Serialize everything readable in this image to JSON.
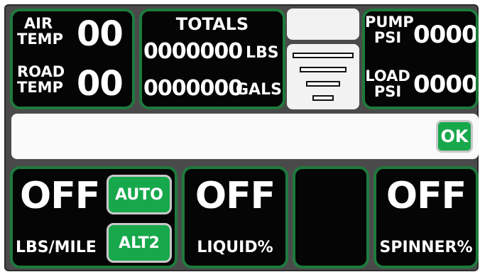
{
  "air_temp": {
    "label_line1": "AIR",
    "label_line2": "TEMP",
    "value": "00"
  },
  "road_temp": {
    "label_line1": "ROAD",
    "label_line2": "TEMP",
    "value": "00"
  },
  "totals": {
    "title": "TOTALS",
    "lbs_value": "0000000",
    "lbs_unit": "LBS",
    "gals_value": "0000000",
    "gals_unit": "GALS"
  },
  "pump_psi": {
    "label_line1": "PUMP",
    "label_line2": "PSI",
    "value": "0000"
  },
  "load_psi": {
    "label_line1": "LOAD",
    "label_line2": "PSI",
    "value": "0000"
  },
  "message_bar": {
    "ok_label": "OK"
  },
  "lbs_mile": {
    "status": "OFF",
    "label": "LBS/MILE",
    "auto_label": "AUTO",
    "alt2_label": "ALT2"
  },
  "liquid": {
    "status": "OFF",
    "label": "LIQUID%"
  },
  "spinner": {
    "status": "OFF",
    "label": "SPINNER%"
  },
  "colors": {
    "panel_border": "#1f7a3e",
    "button_green": "#17a84c",
    "background": "#4a4a4a"
  },
  "icons": {
    "layers": "layers-icon"
  }
}
